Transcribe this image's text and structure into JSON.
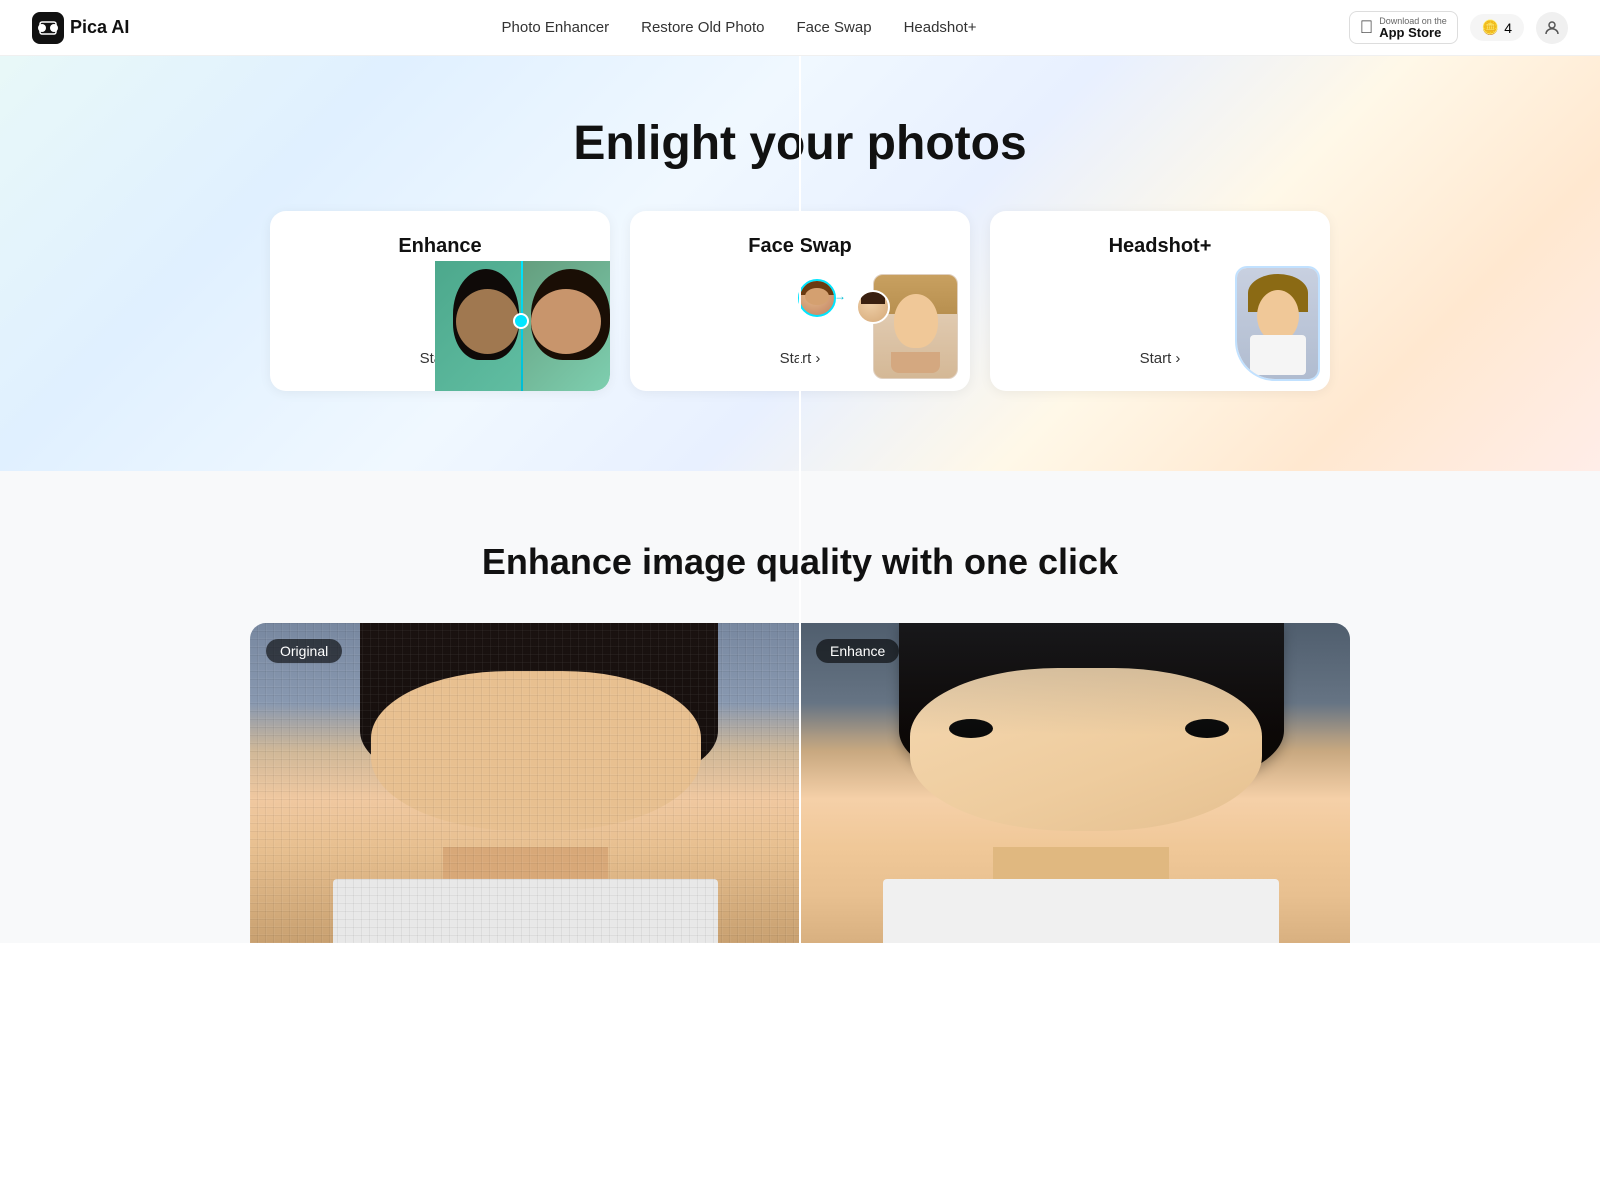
{
  "nav": {
    "logo_text": "Pica AI",
    "links": [
      {
        "label": "Photo Enhancer",
        "href": "#"
      },
      {
        "label": "Restore Old Photo",
        "href": "#"
      },
      {
        "label": "Face Swap",
        "href": "#"
      },
      {
        "label": "Headshot+",
        "href": "#"
      }
    ],
    "app_store": {
      "download_on": "Download on the",
      "store_name": "App Store"
    },
    "credits_icon": "🪙",
    "credits_count": "4"
  },
  "hero": {
    "headline": "Enlight your photos",
    "cards": [
      {
        "id": "enhance",
        "title": "Enhance",
        "start_label": "Start ›"
      },
      {
        "id": "face-swap",
        "title": "Face Swap",
        "start_label": "Start ›"
      },
      {
        "id": "headshot",
        "title": "Headshot+",
        "start_label": "Start ›"
      }
    ]
  },
  "quality_section": {
    "headline": "Enhance image quality with one click",
    "original_label": "Original",
    "enhanced_label": "Enhance"
  }
}
